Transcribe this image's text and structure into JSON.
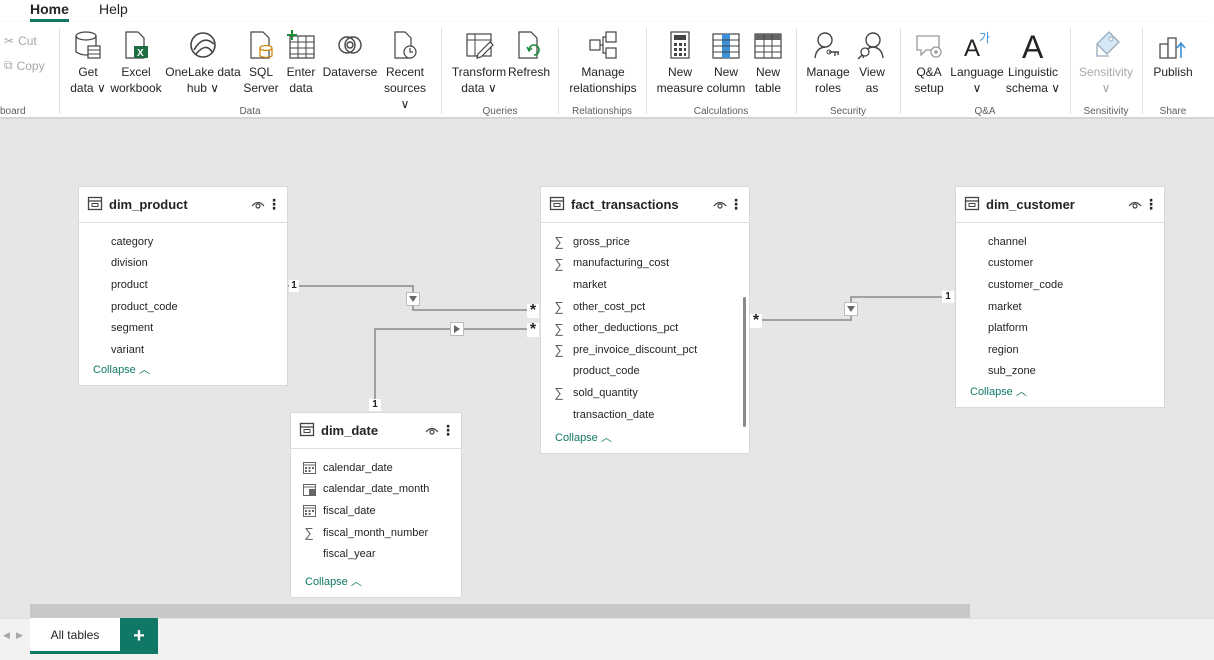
{
  "menu": {
    "tabs": [
      {
        "label": "Home"
      },
      {
        "label": "Help"
      }
    ]
  },
  "ribbon": {
    "clipboard": {
      "cut": "Cut",
      "copy": "Copy",
      "group": "board"
    },
    "data": {
      "get_data": "Get\ndata ∨",
      "excel": "Excel\nworkbook",
      "onelake": "OneLake data\nhub ∨",
      "sql": "SQL\nServer",
      "enter": "Enter\ndata",
      "dataverse": "Dataverse",
      "recent": "Recent\nsources ∨",
      "group": "Data"
    },
    "queries": {
      "transform": "Transform\ndata ∨",
      "refresh": "Refresh",
      "group": "Queries"
    },
    "relationships": {
      "manage": "Manage\nrelationships",
      "group": "Relationships"
    },
    "calculations": {
      "new_measure": "New\nmeasure",
      "new_column": "New\ncolumn",
      "new_table": "New\ntable",
      "group": "Calculations"
    },
    "security": {
      "manage_roles": "Manage\nroles",
      "view_as": "View\nas",
      "group": "Security"
    },
    "qa": {
      "setup": "Q&A\nsetup",
      "language": "Language\n∨",
      "schema": "Linguistic\nschema ∨",
      "group": "Q&A"
    },
    "sensitivity": {
      "label": "Sensitivity\n∨",
      "group": "Sensitivity"
    },
    "share": {
      "publish": "Publish",
      "group": "Share"
    }
  },
  "tables": {
    "dim_product": {
      "name": "dim_product",
      "fields": [
        "category",
        "division",
        "product",
        "product_code",
        "segment",
        "variant"
      ],
      "collapse": "Collapse"
    },
    "fact_transactions": {
      "name": "fact_transactions",
      "fields": [
        "gross_price",
        "manufacturing_cost",
        "market",
        "other_cost_pct",
        "other_deductions_pct",
        "pre_invoice_discount_pct",
        "product_code",
        "sold_quantity",
        "transaction_date"
      ],
      "collapse": "Collapse"
    },
    "dim_customer": {
      "name": "dim_customer",
      "fields": [
        "channel",
        "customer",
        "customer_code",
        "market",
        "platform",
        "region",
        "sub_zone"
      ],
      "collapse": "Collapse"
    },
    "dim_date": {
      "name": "dim_date",
      "fields": [
        "calendar_date",
        "calendar_date_month",
        "fiscal_date",
        "fiscal_month_number",
        "fiscal_year"
      ],
      "collapse": "Collapse"
    }
  },
  "relationships": {
    "one": "1",
    "many": "*"
  },
  "footer": {
    "tab_all": "All tables",
    "add": "+"
  },
  "colors": {
    "accent": "#117865",
    "canvas": "#e6e6e6"
  }
}
